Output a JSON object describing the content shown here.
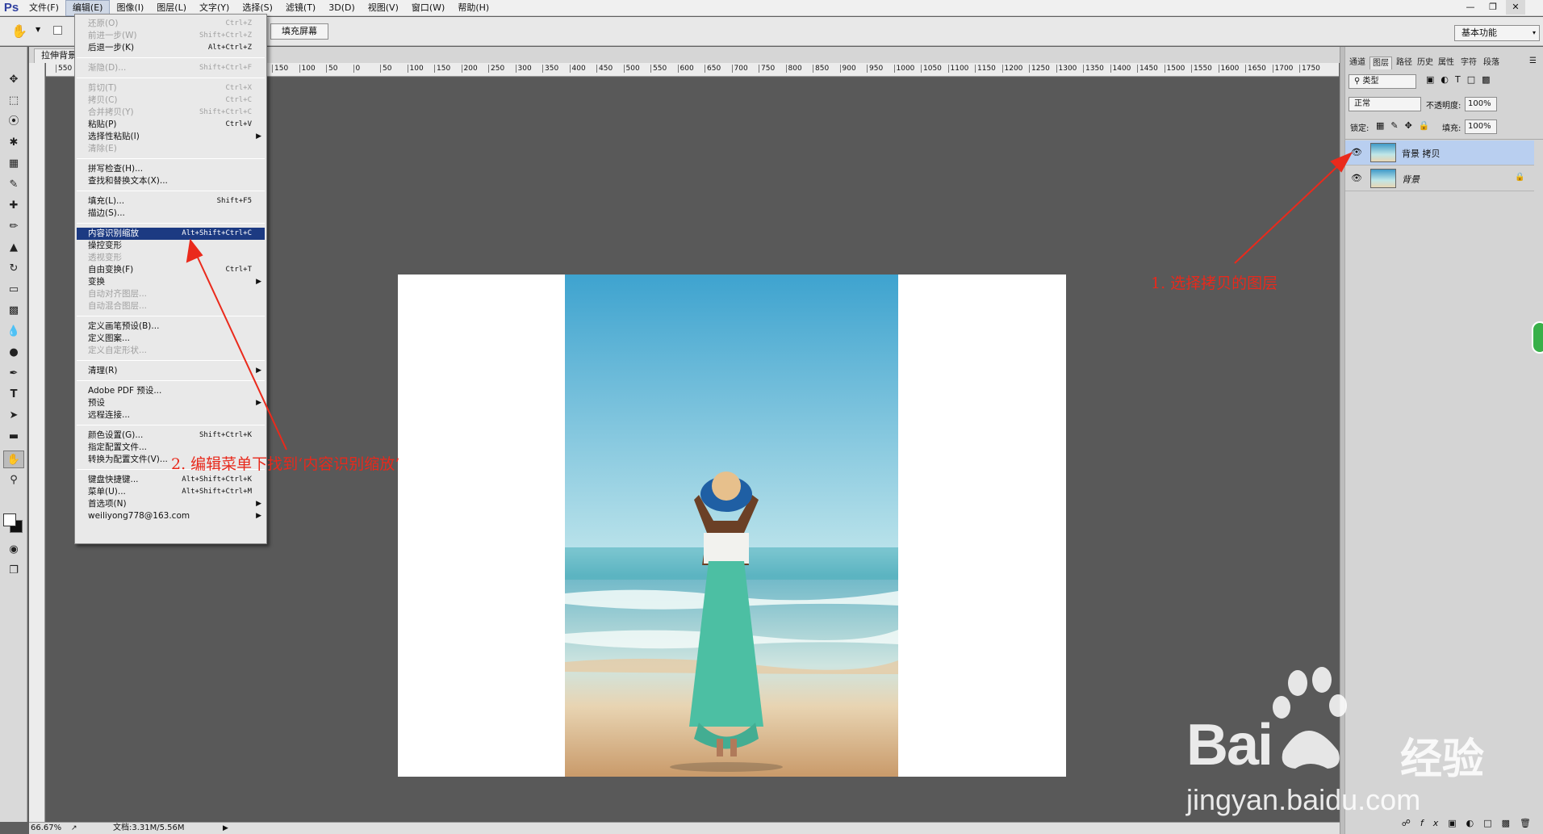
{
  "menubar": {
    "logo": "Ps",
    "items": [
      "文件(F)",
      "编辑(E)",
      "图像(I)",
      "图层(L)",
      "文字(Y)",
      "选择(S)",
      "滤镜(T)",
      "3D(D)",
      "视图(V)",
      "窗口(W)",
      "帮助(H)"
    ]
  },
  "optbar": {
    "fill_screen": "填充屏幕",
    "workspace": "基本功能"
  },
  "doc_tab": "拉伸背景",
  "ruler_labels": [
    "550",
    "500",
    "450",
    "400",
    "350",
    "300",
    "250",
    "200",
    "150",
    "100",
    "50",
    "0",
    "50",
    "100",
    "150",
    "200",
    "250",
    "300",
    "350",
    "400",
    "450",
    "500",
    "550",
    "600",
    "650",
    "700",
    "750",
    "800",
    "850",
    "900",
    "950",
    "1000",
    "1050",
    "1100",
    "1150",
    "1200",
    "1250",
    "1300",
    "1350",
    "1400",
    "1450",
    "1500",
    "1550",
    "1600",
    "1650",
    "1700",
    "1750"
  ],
  "edit_menu": [
    {
      "label": "还原(O)",
      "shortcut": "Ctrl+Z",
      "disabled": true
    },
    {
      "label": "前进一步(W)",
      "shortcut": "Shift+Ctrl+Z",
      "disabled": true
    },
    {
      "label": "后退一步(K)",
      "shortcut": "Alt+Ctrl+Z"
    },
    {
      "sep": true
    },
    {
      "label": "渐隐(D)...",
      "shortcut": "Shift+Ctrl+F",
      "disabled": true
    },
    {
      "sep": true
    },
    {
      "label": "剪切(T)",
      "shortcut": "Ctrl+X",
      "disabled": true
    },
    {
      "label": "拷贝(C)",
      "shortcut": "Ctrl+C",
      "disabled": true
    },
    {
      "label": "合并拷贝(Y)",
      "shortcut": "Shift+Ctrl+C",
      "disabled": true
    },
    {
      "label": "粘贴(P)",
      "shortcut": "Ctrl+V"
    },
    {
      "label": "选择性粘贴(I)",
      "submenu": true
    },
    {
      "label": "清除(E)",
      "disabled": true
    },
    {
      "sep": true
    },
    {
      "label": "拼写检查(H)..."
    },
    {
      "label": "查找和替换文本(X)..."
    },
    {
      "sep": true
    },
    {
      "label": "填充(L)...",
      "shortcut": "Shift+F5"
    },
    {
      "label": "描边(S)..."
    },
    {
      "sep": true
    },
    {
      "label": "内容识别缩放",
      "shortcut": "Alt+Shift+Ctrl+C",
      "highlighted": true
    },
    {
      "label": "操控变形"
    },
    {
      "label": "透视变形",
      "disabled": true
    },
    {
      "label": "自由变换(F)",
      "shortcut": "Ctrl+T"
    },
    {
      "label": "变换",
      "submenu": true
    },
    {
      "label": "自动对齐图层...",
      "disabled": true
    },
    {
      "label": "自动混合图层...",
      "disabled": true
    },
    {
      "sep": true
    },
    {
      "label": "定义画笔预设(B)..."
    },
    {
      "label": "定义图案..."
    },
    {
      "label": "定义自定形状...",
      "disabled": true
    },
    {
      "sep": true
    },
    {
      "label": "清理(R)",
      "submenu": true
    },
    {
      "sep": true
    },
    {
      "label": "Adobe PDF 预设..."
    },
    {
      "label": "预设",
      "submenu": true
    },
    {
      "label": "远程连接..."
    },
    {
      "sep": true
    },
    {
      "label": "颜色设置(G)...",
      "shortcut": "Shift+Ctrl+K"
    },
    {
      "label": "指定配置文件..."
    },
    {
      "label": "转换为配置文件(V)..."
    },
    {
      "sep": true
    },
    {
      "label": "键盘快捷键...",
      "shortcut": "Alt+Shift+Ctrl+K"
    },
    {
      "label": "菜单(U)...",
      "shortcut": "Alt+Shift+Ctrl+M"
    },
    {
      "label": "首选项(N)",
      "submenu": true
    },
    {
      "label": "weiliyong778@163.com",
      "submenu": true
    }
  ],
  "panel": {
    "tabs": [
      "通道",
      "图层",
      "路径",
      "历史",
      "属性",
      "字符",
      "段落"
    ],
    "kind": "类型",
    "blend": "正常",
    "opacity_label": "不透明度:",
    "opacity": "100%",
    "lock_label": "锁定:",
    "fill_label": "填充:",
    "fill": "100%",
    "layers": [
      {
        "name": "背景 拷贝",
        "selected": true
      },
      {
        "name": "背景",
        "locked": true
      }
    ]
  },
  "status": {
    "zoom": "66.67%",
    "doc": "文档:3.31M/5.56M"
  },
  "annotations": {
    "step1": "1.  选择拷贝的图层",
    "step2": "2.  编辑菜单下找到‘内容识别缩放’"
  },
  "colors": {
    "accent": "#e8291c",
    "menu_highlight": "#1c3a82"
  },
  "watermark": {
    "brand": "Bai",
    "suffix": "经验",
    "url": "jingyan.baidu.com"
  }
}
